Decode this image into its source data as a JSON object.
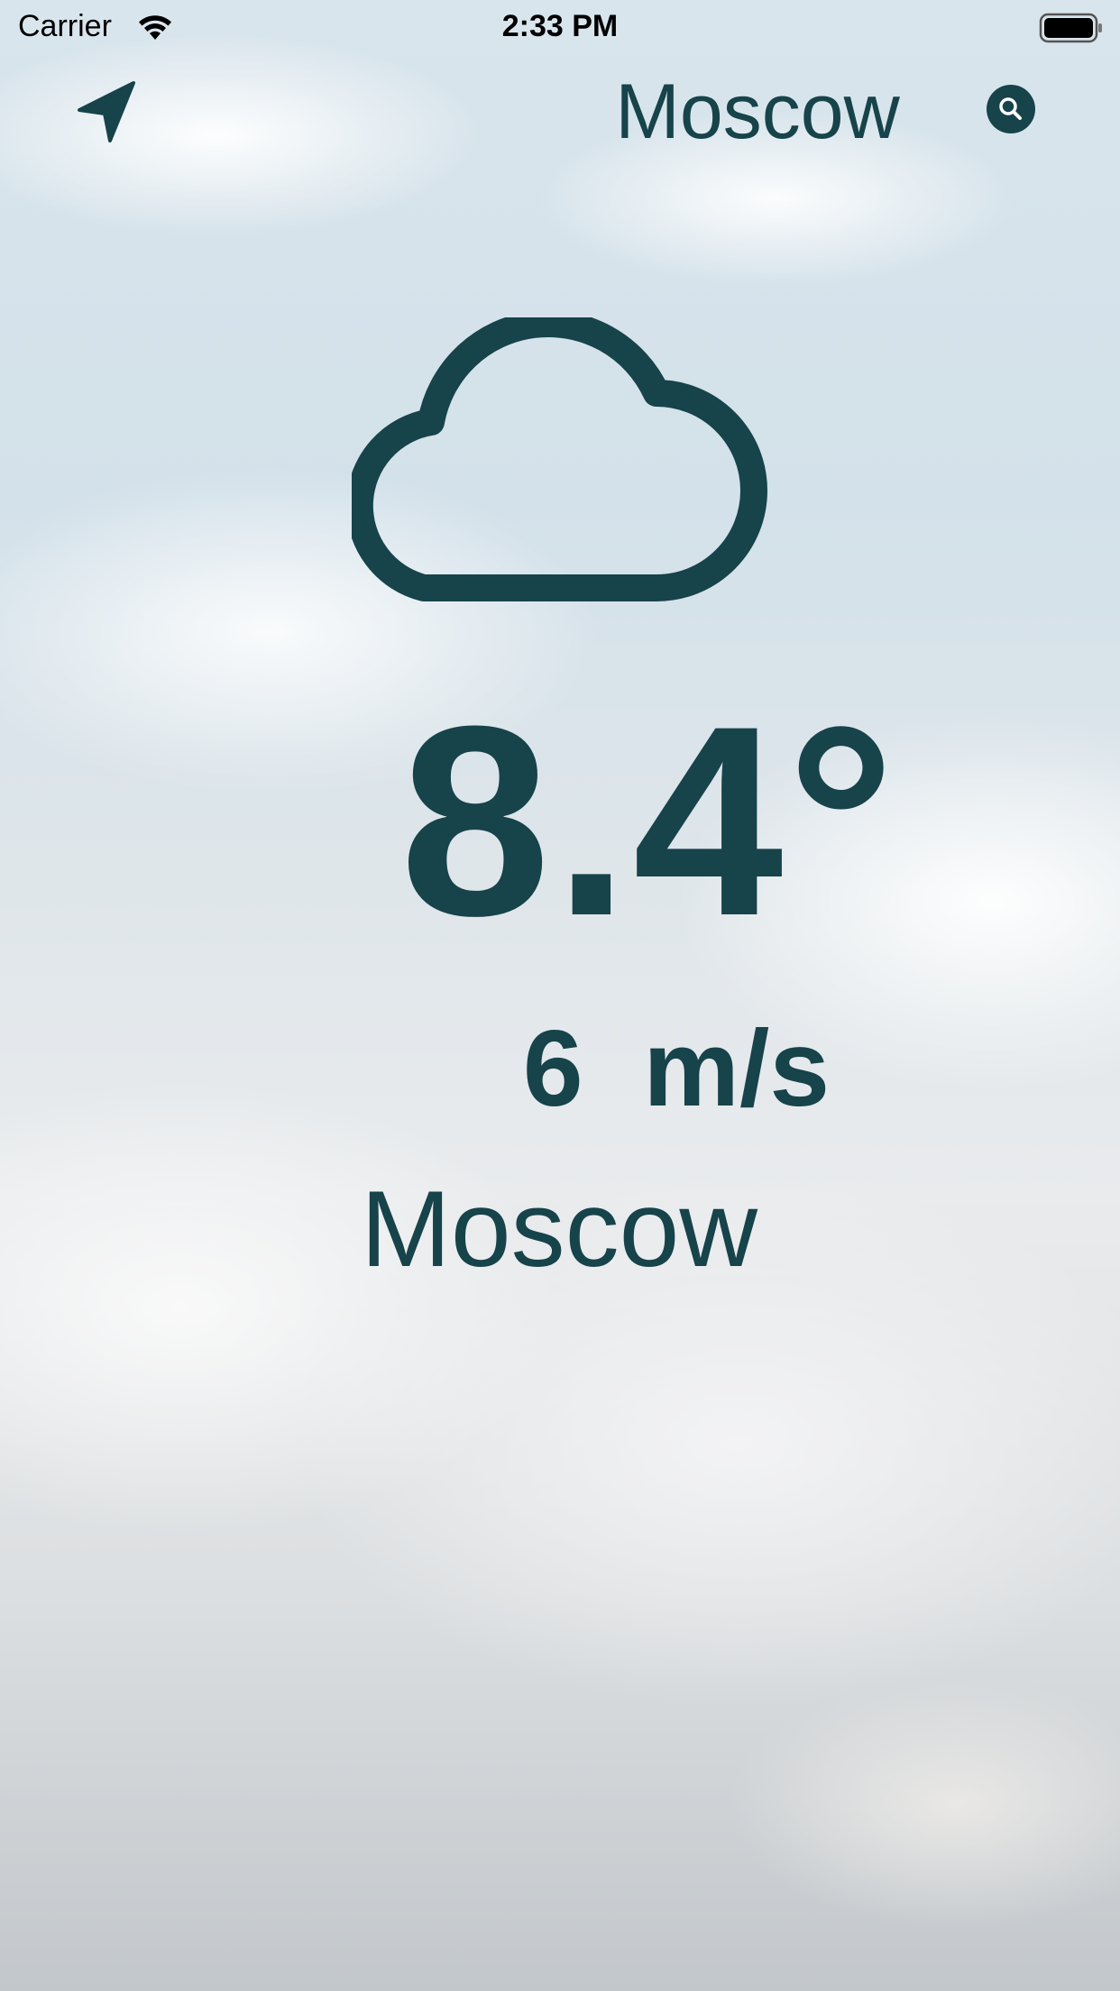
{
  "status_bar": {
    "carrier": "Carrier",
    "time": "2:33 PM"
  },
  "header": {
    "city": "Moscow",
    "location_icon": "location-arrow-icon",
    "search_icon": "search-icon"
  },
  "weather": {
    "condition_icon": "cloud-icon",
    "temperature": "8.4°",
    "wind": "6  m/s",
    "city": "Moscow"
  },
  "colors": {
    "accent": "#17434a"
  }
}
